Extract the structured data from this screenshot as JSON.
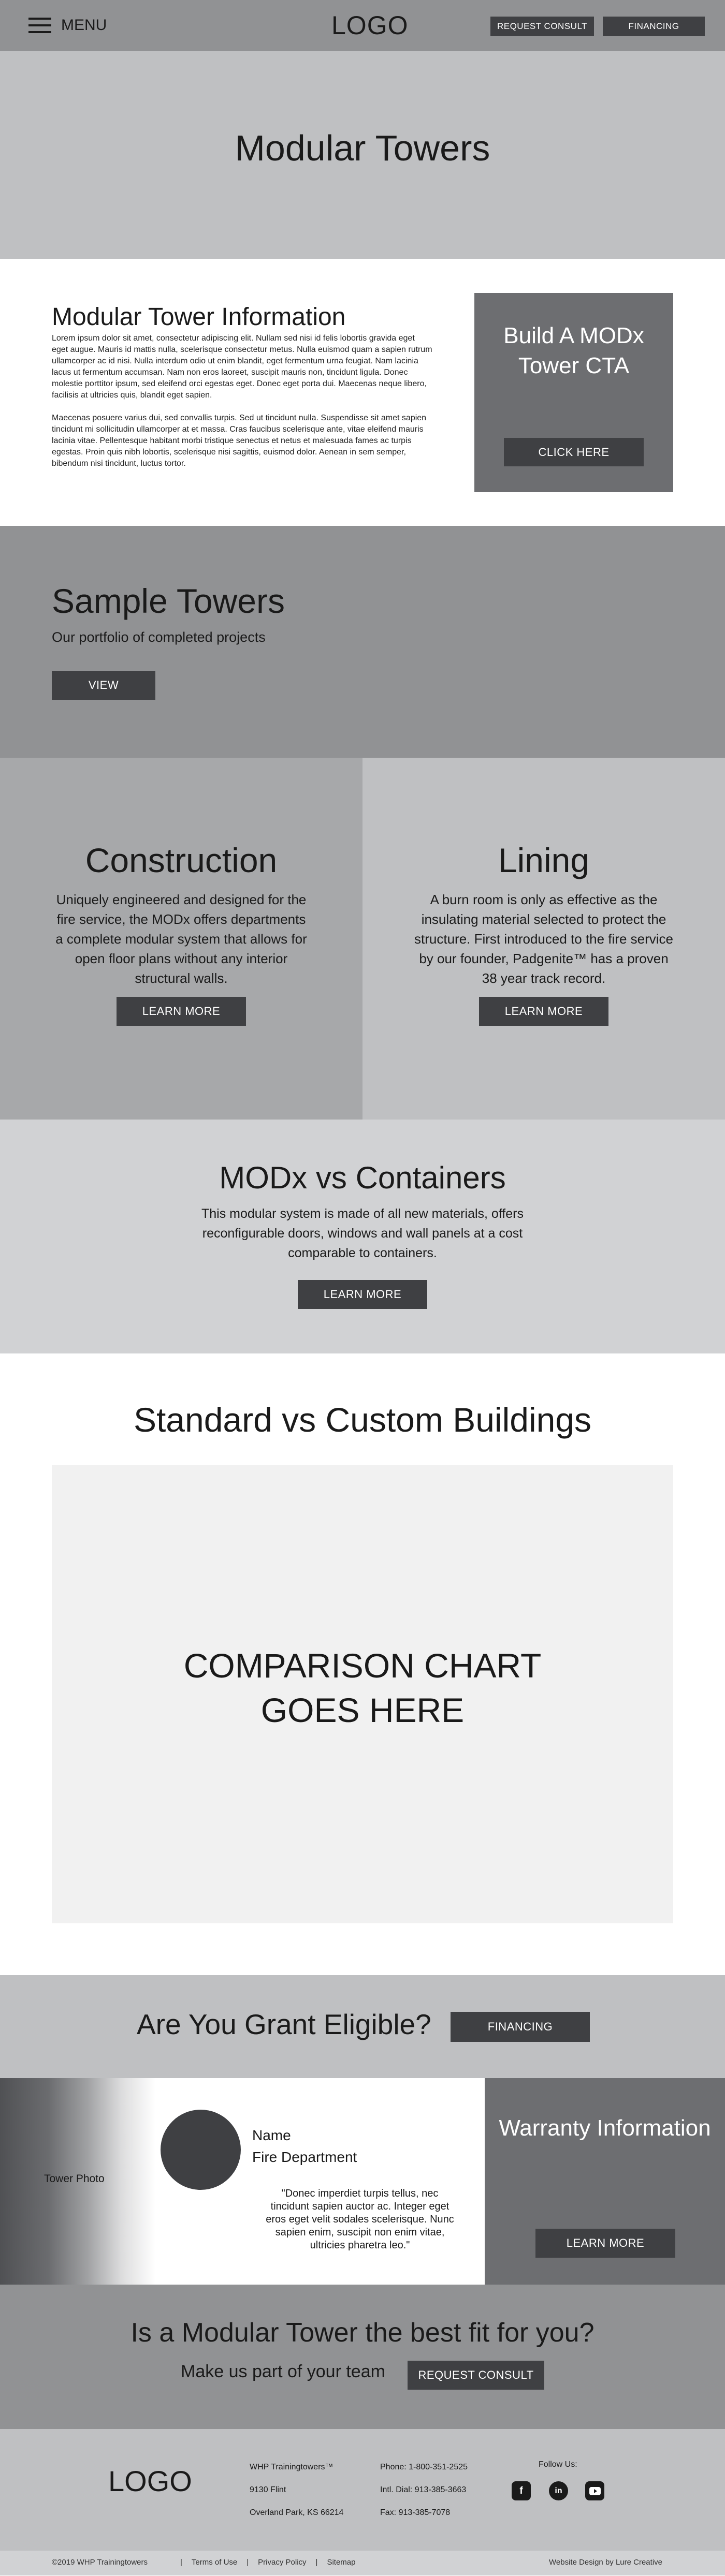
{
  "header": {
    "menu_label": "MENU",
    "logo": "LOGO",
    "request_consult_label": "REQUEST CONSULT",
    "financing_label": "FINANCING"
  },
  "hero": {
    "title": "Modular Towers"
  },
  "info": {
    "title": "Modular Tower Information",
    "paragraph1": "Lorem ipsum dolor sit amet, consectetur adipiscing elit. Nullam sed nisi id felis lobortis gravida eget eget augue. Mauris id mattis nulla, scelerisque consectetur metus. Nulla euismod quam a sapien rutrum ullamcorper ac id nisi. Nulla interdum odio ut enim blandit, eget fermentum urna feugiat. Nam lacinia lacus ut fermentum accumsan. Nam non eros laoreet, suscipit mauris non, tincidunt ligula. Donec molestie porttitor ipsum, sed eleifend orci egestas eget. Donec eget porta dui. Maecenas neque libero, facilisis at ultricies quis, blandit eget sapien.",
    "paragraph2": "Maecenas posuere varius dui, sed convallis turpis. Sed ut tincidunt nulla. Suspendisse sit amet sapien tincidunt mi sollicitudin ullamcorper at et massa. Cras faucibus scelerisque ante, vitae eleifend mauris lacinia vitae. Pellentesque habitant morbi tristique senectus et netus et malesuada fames ac turpis egestas. Proin quis nibh lobortis, scelerisque nisi sagittis, euismod dolor. Aenean in sem semper, bibendum nisi tincidunt, luctus tortor.",
    "cta_title": "Build A MODx Tower CTA",
    "cta_button": "CLICK HERE"
  },
  "samples": {
    "title": "Sample Towers",
    "subtitle": "Our portfolio of completed projects",
    "button": "VIEW"
  },
  "construction": {
    "title": "Construction",
    "text": "Uniquely engineered and designed for the fire service, the MODx offers departments a complete modular system that allows for open floor plans without any interior structural walls.",
    "button": "LEARN MORE"
  },
  "lining": {
    "title": "Lining",
    "text": "A burn room is only as effective as the insulating material selected to protect the structure. First introduced to the fire service by our founder, Padgenite™ has a proven 38 year track record.",
    "button": "LEARN MORE"
  },
  "modx": {
    "title": "MODx vs Containers",
    "text": "This modular system is made of all new materials, offers reconfigurable doors, windows and wall panels at a cost comparable to containers.",
    "button": "LEARN MORE"
  },
  "standard": {
    "title": "Standard vs Custom Buildings",
    "chart_placeholder_line1": "COMPARISON CHART",
    "chart_placeholder_line2": "GOES HERE"
  },
  "grant": {
    "title": "Are You Grant Eligible?",
    "button": "FINANCING"
  },
  "testimonial": {
    "photo_label": "Tower Photo",
    "name": "Name",
    "department": "Fire Department",
    "quote": "\"Donec imperdiet turpis tellus, nec tincidunt sapien auctor ac. Integer eget eros eget velit sodales scelerisque. Nunc sapien enim, suscipit non enim vitae, ultricies pharetra leo.\"",
    "warranty_title": "Warranty Information",
    "warranty_button": "LEARN MORE"
  },
  "bestfit": {
    "title": "Is a Modular Tower the best fit for you?",
    "subtitle": "Make us part of your team",
    "button": "REQUEST CONSULT"
  },
  "footer": {
    "logo": "LOGO",
    "company": "WHP Trainingtowers™",
    "address1": "9130 Flint",
    "address2": "Overland Park, KS 66214",
    "phone": "Phone: 1-800-351-2525",
    "intl_dial": "Intl. Dial: 913-385-3663",
    "fax": "Fax: 913-385-7078",
    "follow": "Follow Us:",
    "social_icons": [
      "facebook-icon",
      "linkedin-icon",
      "youtube-icon"
    ],
    "copyright": "©2019 WHP Trainingtowers",
    "links": [
      "Terms of Use",
      "Privacy Policy",
      "Sitemap"
    ],
    "credit": "Website Design by Lure Creative"
  }
}
